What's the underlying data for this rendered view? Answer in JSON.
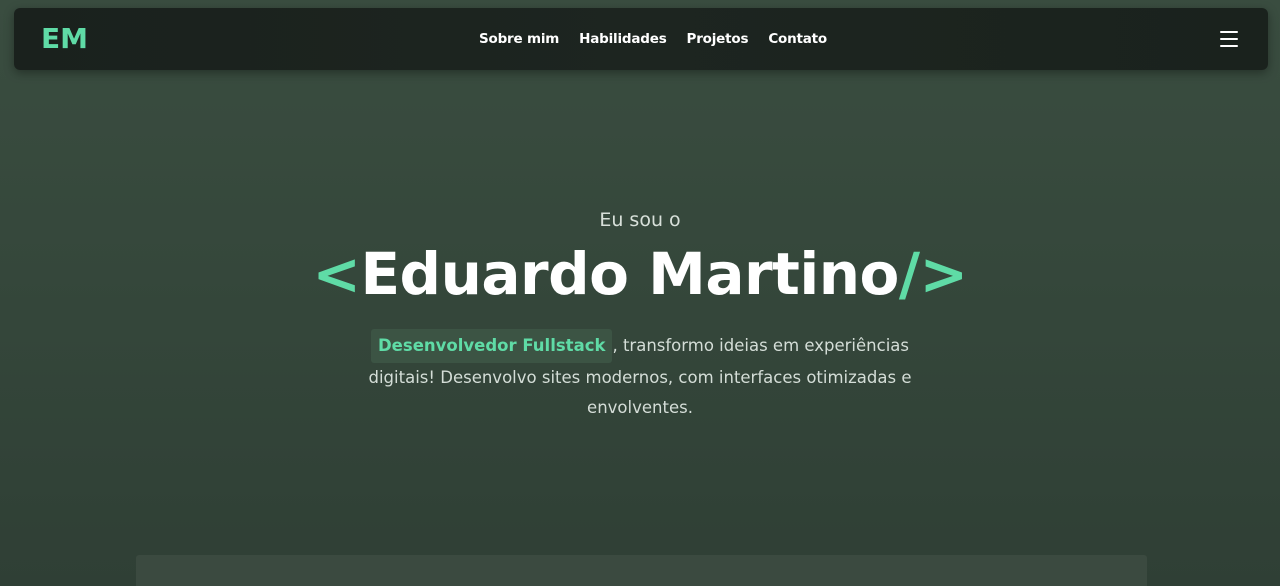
{
  "nav": {
    "logo": "EM",
    "links": [
      "Sobre mim",
      "Habilidades",
      "Projetos",
      "Contato"
    ],
    "menu_icon": "hamburger-menu-icon"
  },
  "hero": {
    "greeting": "Eu sou o",
    "name_open": "<",
    "name": "Eduardo Martino",
    "name_close": "/>",
    "role": "Desenvolvedor Fullstack",
    "description": ", transformo ideias em experiências digitais! Desenvolvo sites modernos, com interfaces otimizadas e envolventes."
  },
  "colors": {
    "accent": "#5fdba6",
    "navbar_bg": "#1c231f",
    "page_bg": "#34463a"
  }
}
